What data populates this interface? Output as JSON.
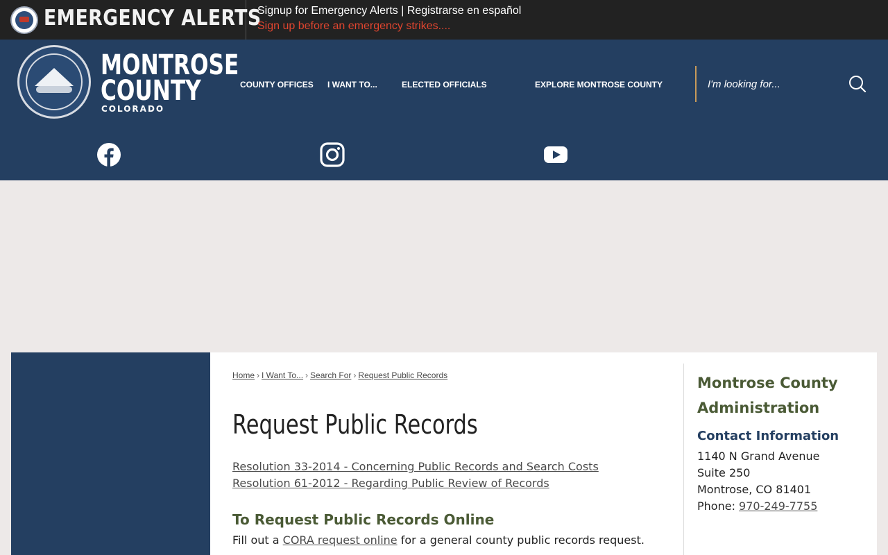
{
  "alert_bar": {
    "title": "EMERGENCY ALERTS",
    "signup_text": "Signup for Emergency Alerts | Registrarse en español",
    "tagline": "Sign up before an emergency strikes....",
    "tagline_color": "#e0452f"
  },
  "header": {
    "brand_line1": "MONTROSE",
    "brand_line2": "COUNTY",
    "brand_line3": "COLORADO",
    "background_color": "#243f61",
    "nav": [
      "COUNTY OFFICES",
      "I WANT TO...",
      "ELECTED OFFICIALS",
      "EXPLORE MONTROSE COUNTY"
    ],
    "search_placeholder": "I'm looking for...",
    "search_icon": "search-icon",
    "social": [
      "facebook-icon",
      "instagram-icon",
      "youtube-icon"
    ]
  },
  "breadcrumb": [
    "Home",
    "I Want To...",
    "Search For",
    "Request Public Records"
  ],
  "main": {
    "title": "Request Public Records",
    "links": [
      "Resolution 33-2014 - Concerning Public Records and Search Costs",
      "Resolution 61-2012 - Regarding Public Review of Records"
    ],
    "section_heading": "To Request Public Records Online",
    "body_prefix": "Fill out a ",
    "body_link": "CORA request online",
    "body_suffix": " for a general county public records request."
  },
  "sidebar": {
    "title": "Montrose County Administration",
    "contact_heading": "Contact Information",
    "address1": "1140 N Grand Avenue",
    "address2": "Suite 250",
    "city": "Montrose, CO 81401",
    "phone_label": "Phone: ",
    "phone": "970-249-7755"
  }
}
